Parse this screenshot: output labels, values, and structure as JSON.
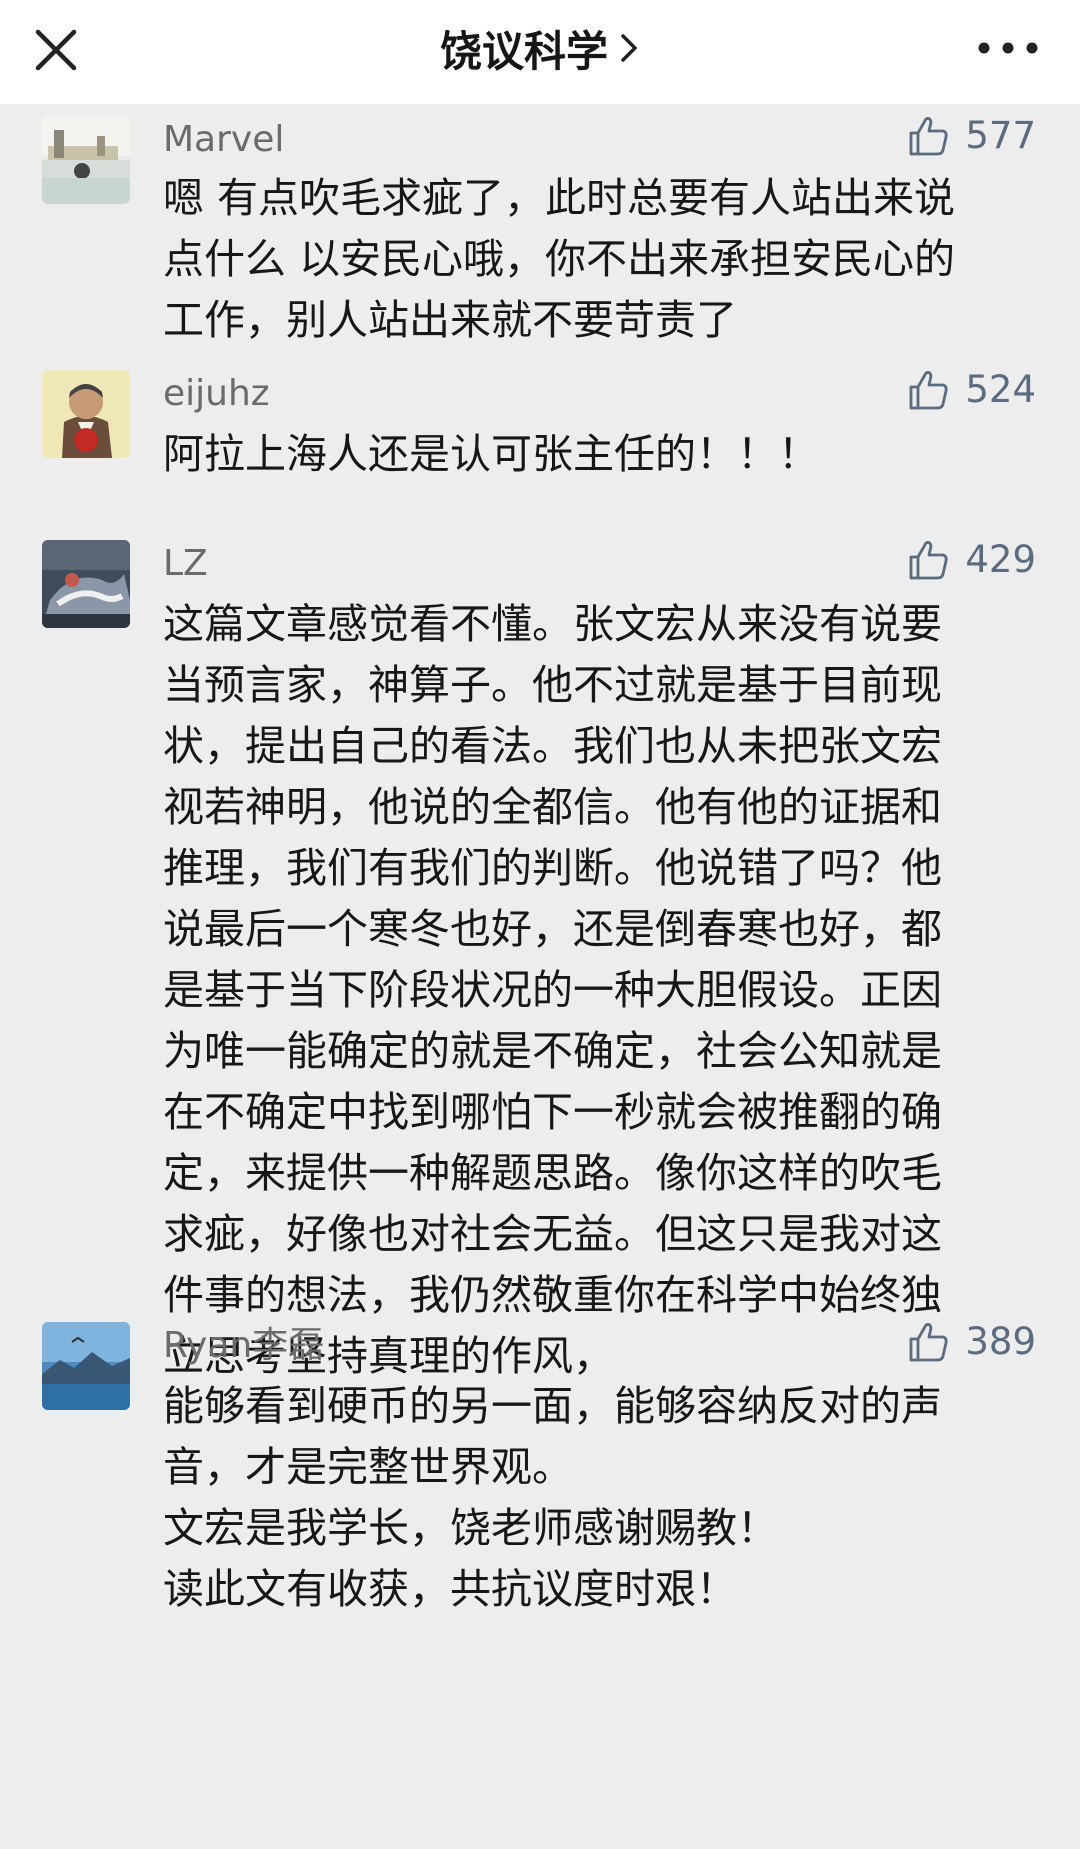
{
  "header": {
    "title": "饶议科学",
    "close_icon": "close-icon",
    "chevron_icon": "chevron-right-icon",
    "more_icon": "more-icon"
  },
  "colors": {
    "header_bg": "#ffffff",
    "page_bg": "#ededed",
    "author": "#6b6b6b",
    "like": "#5b6b80",
    "text": "#171717"
  },
  "comments": [
    {
      "author": "Marvel",
      "likes": "577",
      "avatar_icon": "avatar-image",
      "text": "嗯 有点吹毛求疵了，此时总要有人站出来说\n点什么 以安民心哦，你不出来承担安民心的\n工作，别人站出来就不要苛责了"
    },
    {
      "author": "eijuhz",
      "likes": "524",
      "avatar_icon": "avatar-image",
      "text": "阿拉上海人还是认可张主任的！！！"
    },
    {
      "author": "LZ",
      "likes": "429",
      "avatar_icon": "avatar-image",
      "text": "这篇文章感觉看不懂。张文宏从来没有说要\n当预言家，神算子。他不过就是基于目前现\n状，提出自己的看法。我们也从未把张文宏\n视若神明，他说的全都信。他有他的证据和\n推理，我们有我们的判断。他说错了吗？他\n说最后一个寒冬也好，还是倒春寒也好，都\n是基于当下阶段状况的一种大胆假设。正因\n为唯一能确定的就是不确定，社会公知就是\n在不确定中找到哪怕下一秒就会被推翻的确\n定，来提供一种解题思路。像你这样的吹毛\n求疵，好像也对社会无益。但这只是我对这\n件事的想法，我仍然敬重你在科学中始终独\n立思考坚持真理的作风，"
    },
    {
      "author": "Ryan李磊",
      "likes": "389",
      "avatar_icon": "avatar-image",
      "text": "能够看到硬币的另一面，能够容纳反对的声\n音，才是完整世界观。\n文宏是我学长，饶老师感谢赐教！\n读此文有收获，共抗议度时艰！"
    }
  ]
}
